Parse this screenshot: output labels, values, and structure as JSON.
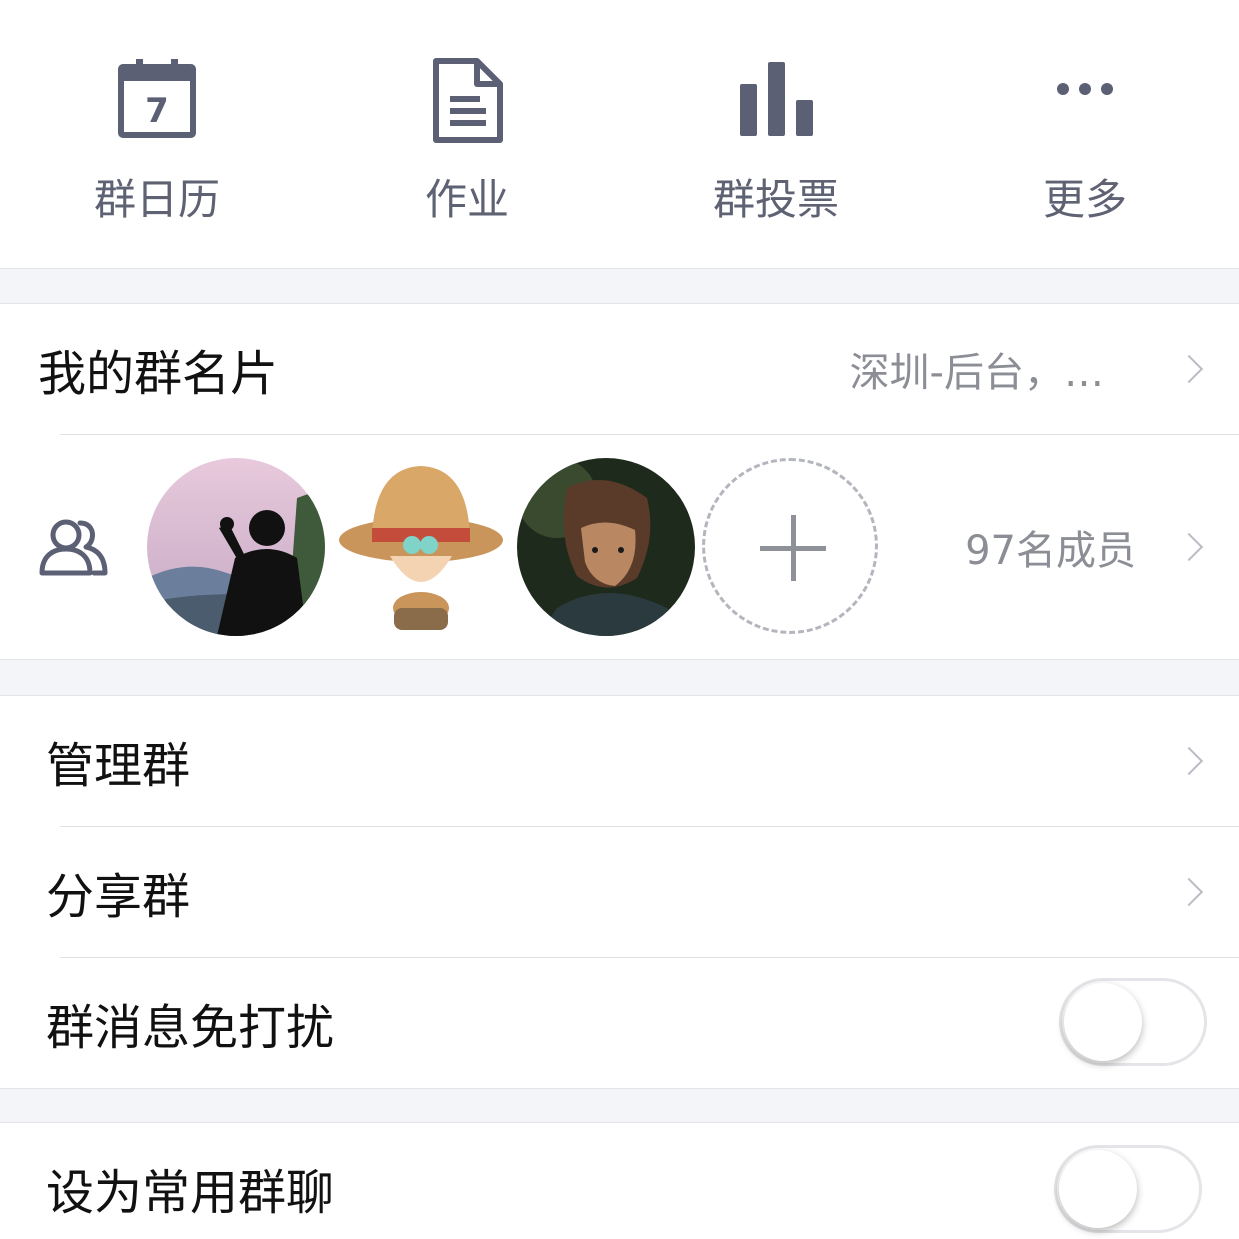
{
  "quick_actions": [
    {
      "label": "群日历",
      "icon": "calendar-icon",
      "day": "7"
    },
    {
      "label": "作业",
      "icon": "document-icon"
    },
    {
      "label": "群投票",
      "icon": "bar-chart-icon"
    },
    {
      "label": "更多",
      "icon": "more-dots-icon"
    }
  ],
  "group_card": {
    "label": "我的群名片",
    "value": "深圳-后台，…"
  },
  "members": {
    "count_label": "97名成员",
    "icon": "members-icon",
    "avatars": [
      "avatar-landscape",
      "avatar-cartoon-hat",
      "avatar-portrait"
    ]
  },
  "settings": [
    {
      "label": "管理群",
      "type": "link"
    },
    {
      "label": "分享群",
      "type": "link"
    },
    {
      "label": "群消息免打扰",
      "type": "toggle",
      "on": false
    },
    {
      "label": "设为常用群聊",
      "type": "toggle",
      "on": false
    }
  ],
  "colors": {
    "icon": "#5c6074",
    "text_secondary": "#8c8e96",
    "divider": "#e1e2e6",
    "section_bg": "#f4f5f8"
  }
}
